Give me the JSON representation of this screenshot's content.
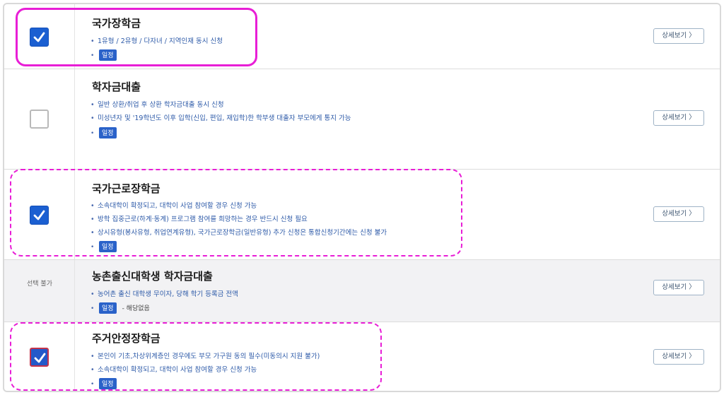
{
  "items": [
    {
      "title": "국가장학금",
      "lines": [
        "1유형 / 2유형 / 다자녀 / 지역인재 동시 신청"
      ],
      "tag": "일정",
      "note": "",
      "checkbox": "checked",
      "button": "상세보기 〉"
    },
    {
      "title": "학자금대출",
      "lines": [
        "일반 상환/취업 후 상환 학자금대출 동시 신청",
        "미성년자 및 '19학년도 이후 입학(신입, 편입, 재입학)한 학부생 대출자 부모에게 통지 가능"
      ],
      "tag": "일정",
      "note": "",
      "checkbox": "unchecked",
      "button": "상세보기 〉"
    },
    {
      "title": "국가근로장학금",
      "lines": [
        "소속대학이 확정되고, 대학이 사업 참여할 경우 신청 가능",
        "방학 집중근로(하계·동계) 프로그램 참여를 희망하는 경우 반드시 신청 필요",
        "상시유형(봉사유형, 취업연계유형), 국가근로장학금(일반유형) 추가 신청은 통합신청기간에는 신청 불가"
      ],
      "tag": "일정",
      "note": "",
      "checkbox": "checked",
      "button": "상세보기 〉"
    },
    {
      "title": "농촌출신대학생 학자금대출",
      "lines": [
        "농어촌 출신 대학생 무이자, 당해 학기 등록금 전액"
      ],
      "tag": "일정",
      "note": "- 해당없음",
      "checkbox": "disabled",
      "disabled_label": "선택 불가",
      "button": "상세보기 〉"
    },
    {
      "title": "주거안정장학금",
      "lines": [
        "본인이 기초,차상위계층인 경우에도 부모 가구원 동의 필수(미동의시 지원 불가)",
        "소속대학이 확정되고, 대학이 사업 참여할 경우 신청 가능"
      ],
      "tag": "일정",
      "note": "",
      "checkbox": "checked",
      "button": "상세보기 〉"
    }
  ],
  "colors": {
    "highlight": "#e81ed6",
    "checkbox": "#1b5fd1",
    "link_text": "#2d5aa8",
    "pill": "#2a62c9"
  }
}
